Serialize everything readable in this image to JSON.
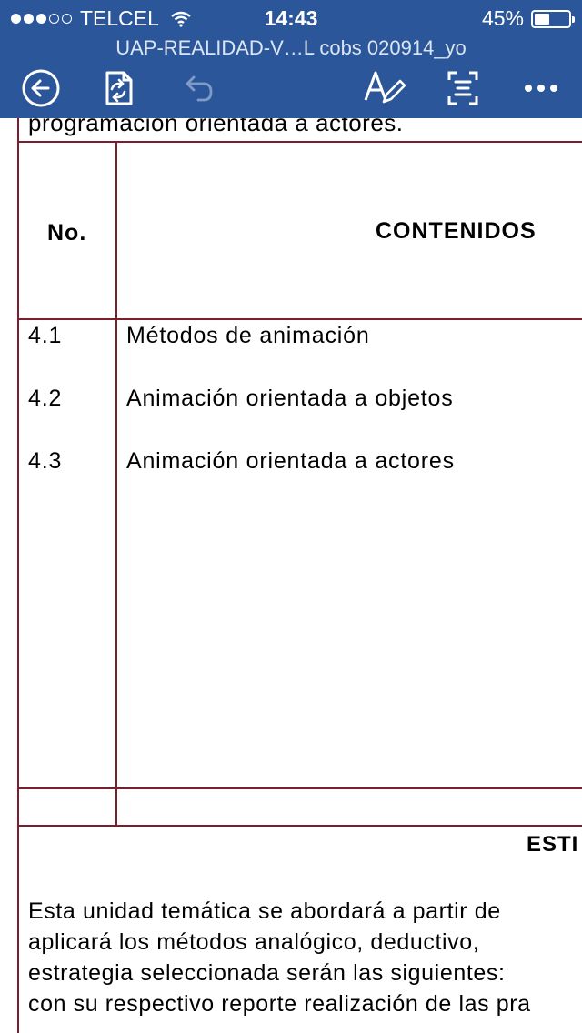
{
  "status_bar": {
    "carrier": "TELCEL",
    "signal_bars_filled": 3,
    "signal_bars_total": 5,
    "time": "14:43",
    "battery_percent": "45%",
    "battery_level": 0.45
  },
  "document": {
    "title": "UAP-REALIDAD-V…L cobs 020914_yo",
    "text_above_table": "programación orientada a actores.",
    "table": {
      "headers": {
        "number": "No.",
        "contents": "CONTENIDOS"
      },
      "rows": [
        {
          "number": "4.1",
          "content": "Métodos de animación"
        },
        {
          "number": "4.2",
          "content": "Animación orientada a objetos"
        },
        {
          "number": "4.3",
          "content": "Animación orientada a actores"
        }
      ]
    },
    "section_heading": "ESTI",
    "paragraph_lines": [
      "Esta unidad temática se abordará a partir de",
      "aplicará los métodos analógico, deductivo,",
      "estrategia seleccionada serán las siguientes:",
      "con su respectivo reporte realización de las pra"
    ]
  },
  "toolbar": {
    "icons": [
      "back-icon",
      "sync-file-icon",
      "undo-icon",
      "edit-text-icon",
      "reading-view-icon",
      "more-icon"
    ]
  },
  "colors": {
    "bar": "#2b579a",
    "table_border": "#7a1f2b"
  }
}
